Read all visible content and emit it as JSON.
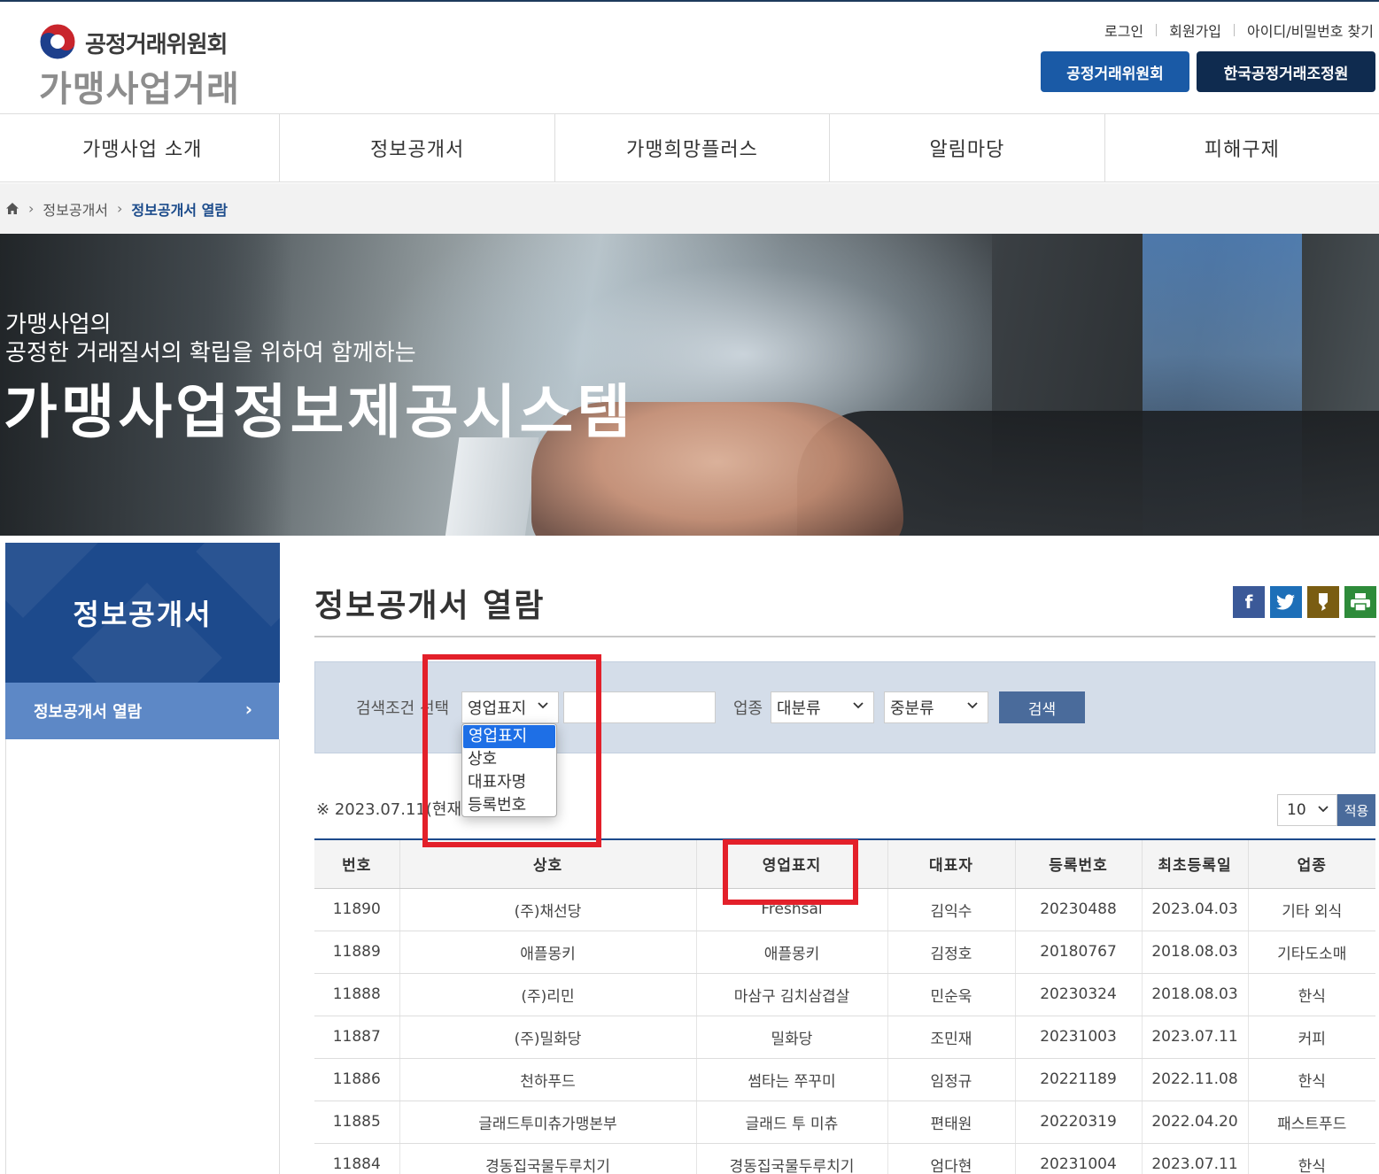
{
  "header": {
    "org_name": "공정거래위원회",
    "site_name": "가맹사업거래",
    "util_links": [
      "로그인",
      "회원가입",
      "아이디/비밀번호 찾기"
    ],
    "btn_ftc": "공정거래위원회",
    "btn_kfair": "한국공정거래조정원"
  },
  "gnb": [
    "가맹사업 소개",
    "정보공개서",
    "가맹희망플러스",
    "알림마당",
    "피해구제"
  ],
  "breadcrumb": {
    "home_icon": "home-icon",
    "level1": "정보공개서",
    "current": "정보공개서 열람"
  },
  "banner": {
    "line1": "가맹사업의",
    "line2": "공정한 거래질서의 확립을 위하여 함께하는",
    "headline": "가맹사업정보제공시스템"
  },
  "lnb": {
    "title": "정보공개서",
    "item": "정보공개서 열람",
    "item_arrow": "›"
  },
  "content": {
    "title": "정보공개서 열람",
    "sns_icons": [
      "facebook-icon",
      "twitter-icon",
      "kakaostory-icon",
      "print-icon"
    ],
    "colors": {
      "facebook": "#3b5998",
      "twitter": "#1d6fb8",
      "kakao": "#7a5d12",
      "print": "#2e8b3a",
      "highlight": "#e3202a"
    }
  },
  "search": {
    "condition_label": "검색조건 선택",
    "condition_selected": "영업표지",
    "condition_options": [
      "영업표지",
      "상호",
      "대표자명",
      "등록번호"
    ],
    "keyword": "",
    "category_label": "업종",
    "major_category": "대분류",
    "minor_category": "중분류",
    "search_button": "검색"
  },
  "notice": {
    "mark": "※",
    "date": "2023.07.11",
    "suffix": "(현재"
  },
  "pager": {
    "page_size": "10",
    "apply_button": "적용"
  },
  "table": {
    "headers": [
      "번호",
      "상호",
      "영업표지",
      "대표자",
      "등록번호",
      "최초등록일",
      "업종"
    ],
    "rows": [
      [
        "11890",
        "(주)채선당",
        "Freshsal",
        "김익수",
        "20230488",
        "2023.04.03",
        "기타 외식"
      ],
      [
        "11889",
        "애플몽키",
        "애플몽키",
        "김정호",
        "20180767",
        "2018.08.03",
        "기타도소매"
      ],
      [
        "11888",
        "(주)리민",
        "마삼구 김치삼겹살",
        "민순욱",
        "20230324",
        "2018.08.03",
        "한식"
      ],
      [
        "11887",
        "(주)밀화당",
        "밀화당",
        "조민재",
        "20231003",
        "2023.07.11",
        "커피"
      ],
      [
        "11886",
        "천하푸드",
        "썸타는 쭈꾸미",
        "임정규",
        "20221189",
        "2022.11.08",
        "한식"
      ],
      [
        "11885",
        "글래드투미츄가맹본부",
        "글래드 투 미츄",
        "편태원",
        "20220319",
        "2022.04.20",
        "패스트푸드"
      ],
      [
        "11884",
        "경동집국물두루치기",
        "경동집국물두루치기",
        "엄다현",
        "20231004",
        "2023.07.11",
        "한식"
      ]
    ]
  }
}
